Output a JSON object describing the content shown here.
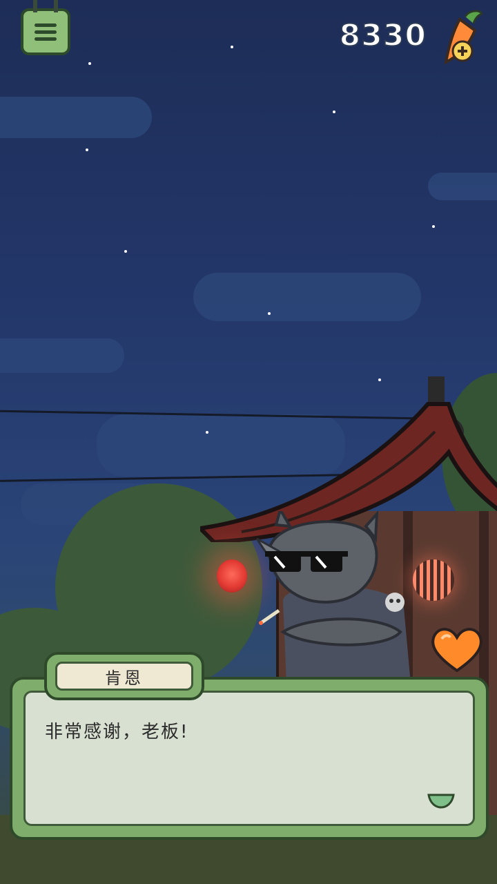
{
  "hud": {
    "carrot_count": "8330",
    "menu_icon": "menu-list-icon",
    "add_carrot_icon": "carrot-plus-icon"
  },
  "dialog": {
    "speaker_name": "肯恩",
    "message": "非常感谢，老板!",
    "next_icon": "chevron-down-icon"
  },
  "character": {
    "affection_icon": "heart-icon",
    "heart_color": "#ff8a2a"
  },
  "colors": {
    "ui_green": "#7fae6c",
    "ui_border": "#2e4a2a",
    "night_sky": "#1d2d57"
  }
}
